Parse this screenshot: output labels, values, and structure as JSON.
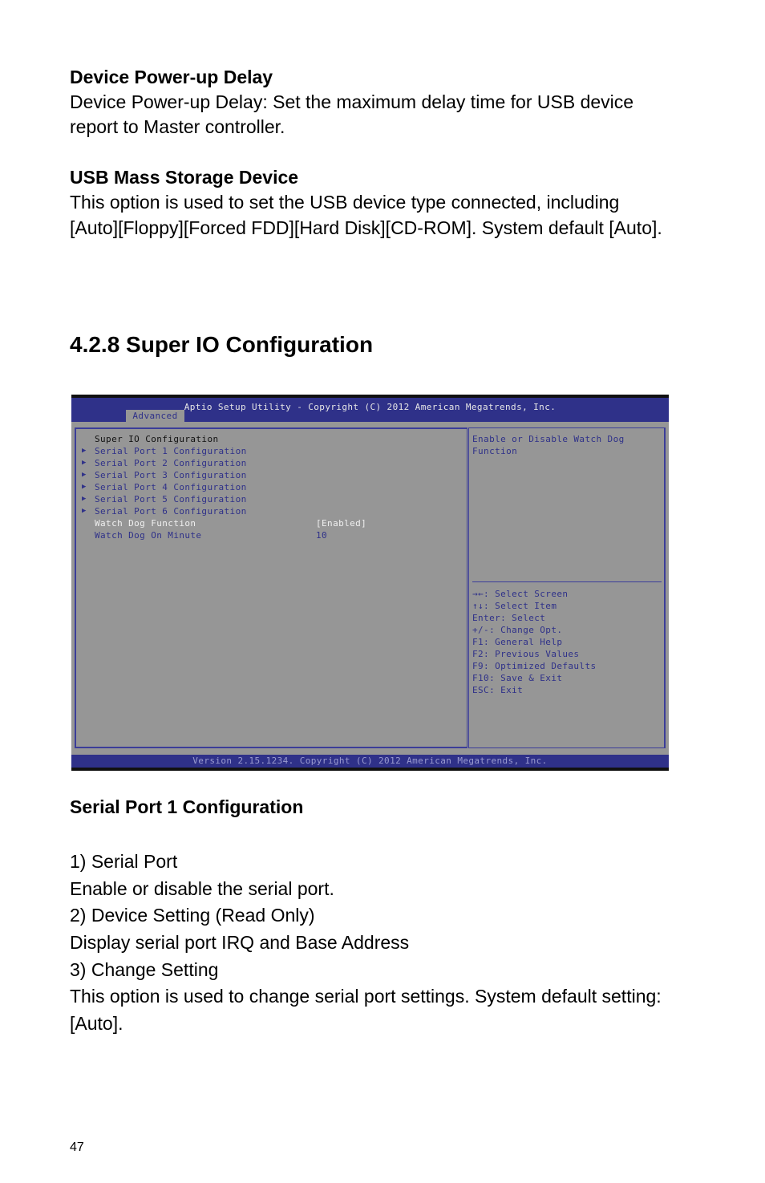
{
  "sections": [
    {
      "heading": "Device Power-up Delay",
      "lines": [
        "Device Power-up Delay: Set the maximum delay time for USB device",
        "report to Master controller."
      ]
    },
    {
      "heading": "USB Mass Storage Device",
      "lines": [
        "This option is used to set the USB device type connected, including",
        "[Auto][Floppy][Forced FDD][Hard Disk][CD-ROM]. System default [Auto]."
      ]
    }
  ],
  "section_title": "4.2.8 Super IO Configuration",
  "bios": {
    "title": "Aptio Setup Utility - Copyright (C) 2012 American Megatrends, Inc.",
    "active_tab": "Advanced",
    "page_heading": "Super IO Configuration",
    "submenus": [
      {
        "label": "Serial Port 1 Configuration",
        "icon": "triangle-right-icon"
      },
      {
        "label": "Serial Port 2 Configuration",
        "icon": "triangle-right-icon"
      },
      {
        "label": "Serial Port 3 Configuration",
        "icon": "triangle-right-icon"
      },
      {
        "label": "Serial Port 4 Configuration",
        "icon": "triangle-right-icon"
      },
      {
        "label": "Serial Port 5 Configuration",
        "icon": "triangle-right-icon"
      },
      {
        "label": "Serial Port 6 Configuration",
        "icon": "triangle-right-icon"
      }
    ],
    "settings": [
      {
        "label": "Watch Dog Function",
        "value": "[Enabled]",
        "selected": true
      },
      {
        "label": "Watch Dog On Minute",
        "value": "10",
        "selected": false
      }
    ],
    "help_text": [
      "Enable or Disable Watch Dog",
      "Function"
    ],
    "key_help": [
      "→←: Select Screen",
      "↑↓: Select Item",
      "Enter: Select",
      "+/-: Change Opt.",
      "F1: General Help",
      "F2: Previous Values",
      "F9: Optimized Defaults",
      "F10: Save & Exit",
      "ESC: Exit"
    ],
    "footer": "Version 2.15.1234. Copyright (C) 2012 American Megatrends, Inc.",
    "colors": {
      "header_bg": "#2f3189",
      "panel_bg": "#969696",
      "text_blue": "#2f3189",
      "text_highlight": "#f0f0f0"
    }
  },
  "serial_port_section": {
    "heading": "Serial Port 1 Configuration",
    "lines": [
      "1) Serial Port",
      "Enable or disable the serial port.",
      "2) Device Setting (Read Only)",
      "Display serial port IRQ and Base Address",
      "3) Change Setting",
      "This option is used to change serial port settings. System default setting:",
      "[Auto]."
    ]
  },
  "page_number": "47"
}
